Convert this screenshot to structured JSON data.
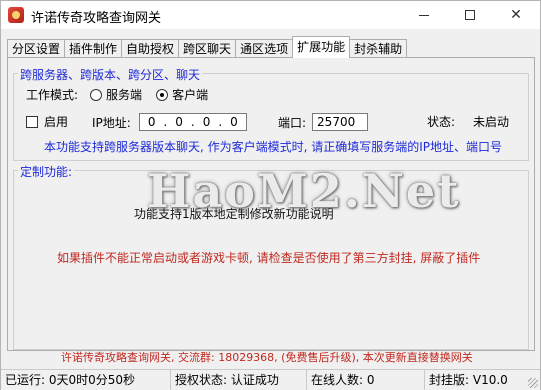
{
  "window": {
    "title": "许诺传奇攻略查询网关",
    "minimize_label": "—",
    "maximize_label": "□",
    "close_label": "✕"
  },
  "tabs": [
    {
      "label": "分区设置"
    },
    {
      "label": "插件制作"
    },
    {
      "label": "自助授权"
    },
    {
      "label": "跨区聊天"
    },
    {
      "label": "通区选项"
    },
    {
      "label": "扩展功能",
      "active": true
    },
    {
      "label": "封杀辅助"
    }
  ],
  "group1": {
    "legend": "跨服务器、跨版本、跨分区、聊天",
    "mode_label": "工作模式:",
    "server_option": "服务端",
    "client_option": "客户端",
    "selected_mode": "客户端",
    "enable_label": "启用",
    "enable_checked": false,
    "ip_label": "IP地址:",
    "ip_octets": [
      "0",
      "0",
      "0",
      "0"
    ],
    "ip_separator": ".",
    "port_label": "端口:",
    "port_value": "25700",
    "status_label": "状态:",
    "status_value": "未启动",
    "note": "本功能支持跨服务器版本聊天, 作为客户端模式时, 请正确填写服务端的IP地址、端口号"
  },
  "group2": {
    "legend": "定制功能:",
    "watermark": "HaoM2.Net",
    "black_note": "功能支持1版本地定制修改新功能说明",
    "warning": "如果插件不能正常启动或者游戏卡顿, 请检查是否使用了第三方封挂, 屏蔽了插件"
  },
  "footer_note": "许诺传奇攻略查询网关, 交流群: 18029368, (免费售后升级), 本次更新直接替换网关",
  "statusbar": {
    "runtime": "已运行: 0天0时0分50秒",
    "auth": "授权状态: 认证成功",
    "online": "在线人数: 0",
    "version": "封挂版: V10.0"
  },
  "colors": {
    "accent_blue": "#1e2ad8",
    "warning_red": "#c0281f"
  }
}
